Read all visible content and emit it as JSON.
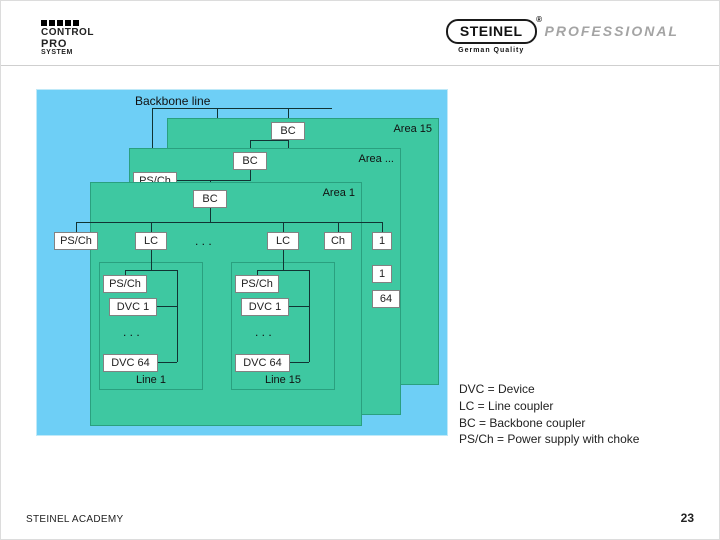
{
  "logoLeft": {
    "l1": "CONTROL",
    "l2": "PRO",
    "l3": "SYSTEM"
  },
  "logoRight": {
    "brand": "STEINEL",
    "reg": "®",
    "sub": "German Quality",
    "prof": "PROFESSIONAL"
  },
  "diagram": {
    "backboneLabel": "Backbone line",
    "areas": [
      {
        "label": "Area 15"
      },
      {
        "label": "Area ..."
      },
      {
        "label": "Area 1"
      }
    ],
    "bc": "BC",
    "psch": "PS/Ch",
    "lc": "LC",
    "dvc1": "DVC 1",
    "dvc64": "DVC 64",
    "n1": "1",
    "n64": "64",
    "ellipsis": ". . .",
    "lines": [
      {
        "label": "Line 1"
      },
      {
        "label": "Line 15"
      }
    ],
    "treeExtra": "Ch"
  },
  "legend": {
    "l1": "DVC = Device",
    "l2": "LC = Line coupler",
    "l3": "BC = Backbone coupler",
    "l4": "PS/Ch = Power supply with choke"
  },
  "footer": {
    "left": "STEINEL ACADEMY",
    "page": "23"
  }
}
